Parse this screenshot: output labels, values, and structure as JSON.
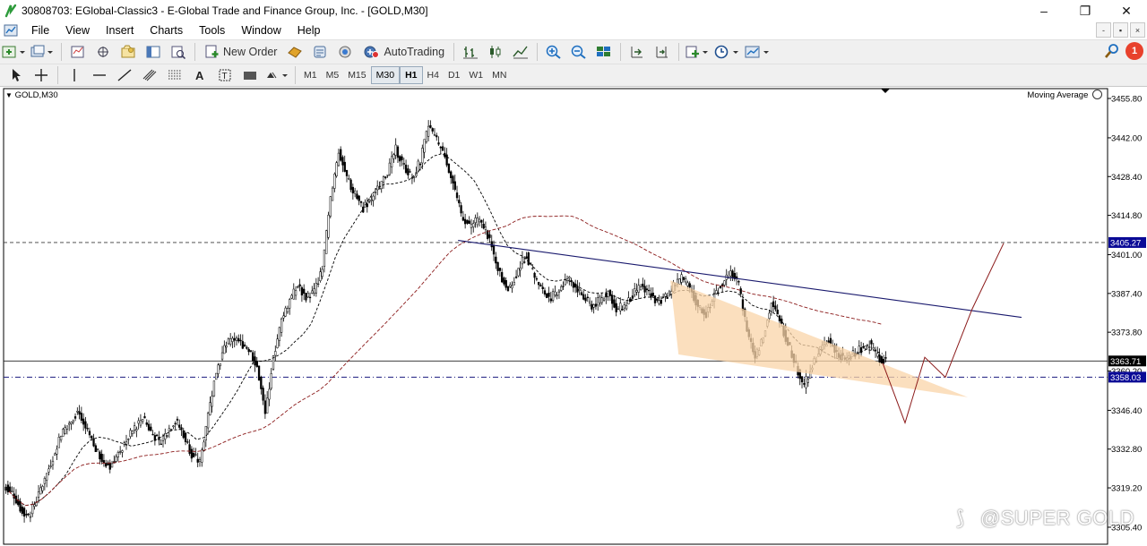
{
  "window": {
    "title": "30808703: EGlobal-Classic3 - E-Global Trade and Finance Group, Inc. - [GOLD,M30]",
    "controls": {
      "minimize": "–",
      "restore": "❐",
      "close": "✕"
    }
  },
  "menu": {
    "items": [
      "File",
      "View",
      "Insert",
      "Charts",
      "Tools",
      "Window",
      "Help"
    ],
    "mdi_controls": {
      "minimize": "-",
      "restore": "▪",
      "close": "×"
    }
  },
  "toolbar": {
    "new_order_label": "New Order",
    "autotrading_label": "AutoTrading",
    "notification_count": "1"
  },
  "timeframes": {
    "items": [
      "M1",
      "M5",
      "M15",
      "M30",
      "H1",
      "H4",
      "D1",
      "W1",
      "MN"
    ],
    "selected": "M30",
    "highlighted": "H1"
  },
  "chart": {
    "symbol_label": "GOLD,M30",
    "indicator_label": "Moving Average",
    "price_levels": [
      "3455.80",
      "3442.00",
      "3428.40",
      "3414.80",
      "3401.00",
      "3387.40",
      "3373.80",
      "3360.20",
      "3346.40",
      "3332.80",
      "3319.20",
      "3305.40"
    ],
    "highlighted_prices": {
      "resistance": "3405.27",
      "current": "3363.71",
      "support": "3358.03"
    },
    "colors": {
      "candles": "#000000",
      "ma_fast": "#000000",
      "ma_slow": "#8b1a1a",
      "trendline": "#1a1a6e",
      "triangle_fill": "#f9d4a8",
      "projection": "#8b1a1a",
      "price_tag": "#0a0a96"
    },
    "watermark": "@SUPER GOLD"
  },
  "chart_data": {
    "type": "candlestick",
    "symbol": "GOLD",
    "timeframe": "M30",
    "ylim": [
      3305.4,
      3455.8
    ],
    "yticks": [
      3305.4,
      3319.2,
      3332.8,
      3346.4,
      3360.2,
      3373.8,
      3387.4,
      3401.0,
      3414.8,
      3428.4,
      3442.0,
      3455.8
    ],
    "current_price": 3363.71,
    "horizontal_lines": [
      3405.27,
      3363.71,
      3358.03
    ],
    "close_series": [
      3318,
      3312,
      3309,
      3315,
      3322,
      3330,
      3338,
      3342,
      3346,
      3340,
      3334,
      3329,
      3327,
      3331,
      3336,
      3340,
      3344,
      3339,
      3335,
      3339,
      3343,
      3338,
      3331,
      3328,
      3345,
      3360,
      3368,
      3372,
      3370,
      3368,
      3362,
      3345,
      3365,
      3378,
      3385,
      3390,
      3386,
      3388,
      3396,
      3420,
      3437,
      3428,
      3422,
      3417,
      3421,
      3425,
      3430,
      3438,
      3432,
      3428,
      3434,
      3446,
      3441,
      3436,
      3426,
      3415,
      3411,
      3413,
      3410,
      3401,
      3392,
      3389,
      3396,
      3401,
      3393,
      3388,
      3386,
      3389,
      3393,
      3390,
      3386,
      3383,
      3385,
      3388,
      3382,
      3383,
      3387,
      3390,
      3388,
      3384,
      3386,
      3390,
      3393,
      3389,
      3383,
      3380,
      3387,
      3391,
      3395,
      3390,
      3375,
      3365,
      3372,
      3384,
      3378,
      3370,
      3362,
      3355,
      3362,
      3368,
      3371,
      3367,
      3364,
      3366,
      3368,
      3370,
      3365,
      3363.71
    ]
  }
}
